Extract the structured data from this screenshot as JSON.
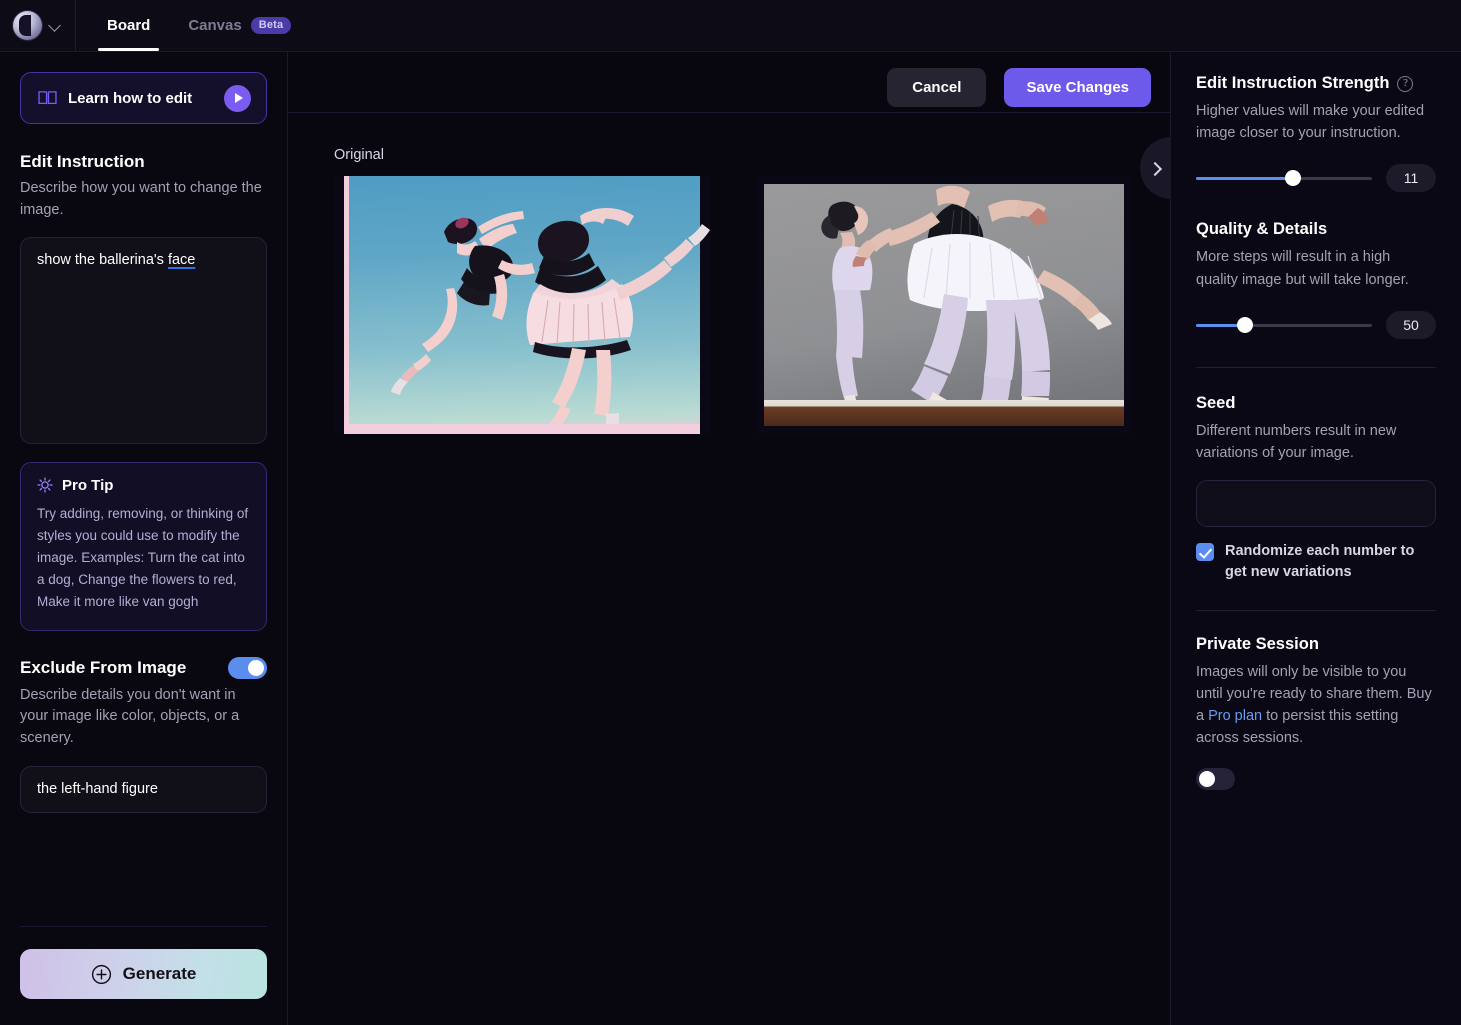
{
  "topbar": {
    "logo_name": "app-logo",
    "tabs": [
      {
        "label": "Board",
        "active": true
      },
      {
        "label": "Canvas",
        "active": false,
        "badge": "Beta"
      }
    ]
  },
  "sidebar": {
    "learn": {
      "label": "Learn how to edit",
      "icon": "book-icon",
      "play_icon": "play-icon"
    },
    "edit_instruction": {
      "title": "Edit Instruction",
      "description": "Describe how you want to change the image.",
      "value_head": "show the ballerina's ",
      "value_misspelled": "face",
      "placeholder": "Describe how you want to change the image."
    },
    "pro_tip": {
      "title": "Pro Tip",
      "icon": "lightbulb-icon",
      "body": "Try adding, removing, or thinking of styles you could use to modify the image. Examples: Turn the cat into a dog, Change the flowers to red, Make it more like van gogh"
    },
    "exclude": {
      "title": "Exclude From Image",
      "toggle_state": "on",
      "description": "Describe details you don't want in your image like color, objects, or a scenery.",
      "value": "the left-hand figure",
      "placeholder": "Describe details you don't want in your image"
    },
    "generate": {
      "label": "Generate",
      "icon": "plus-circle-icon"
    }
  },
  "center": {
    "cancel_label": "Cancel",
    "save_label": "Save Changes",
    "original_label": "Original",
    "images": [
      {
        "alt": "anime ballerinas original image"
      },
      {
        "alt": "photorealistic ballerinas edited image"
      }
    ]
  },
  "right": {
    "collapse_icon": "chevron-right-icon",
    "strength": {
      "title": "Edit Instruction Strength",
      "help_icon": "help-icon",
      "help_glyph": "?",
      "description": "Higher values will make your edited image closer to your instruction.",
      "value": "11",
      "percent": 55
    },
    "quality": {
      "title": "Quality & Details",
      "description": "More steps will result in a high quality image but will take longer.",
      "value": "50",
      "percent": 28
    },
    "seed": {
      "title": "Seed",
      "description": "Different numbers result in new variations of your image.",
      "value": "",
      "placeholder": "",
      "randomize_label": "Randomize each number to get new variations",
      "randomize_checked": true
    },
    "private": {
      "title": "Private Session",
      "desc_part1": "Images will only be visible to you until you're ready to share them. Buy a ",
      "link_label": "Pro plan",
      "desc_part2": " to persist this setting across sessions.",
      "toggle_state": "off"
    }
  },
  "colors": {
    "accent_purple": "#6d5aeb",
    "accent_blue": "#5b8def",
    "link_blue": "#6c9bf2",
    "bg": "#08060f",
    "panel": "#0a0814"
  }
}
